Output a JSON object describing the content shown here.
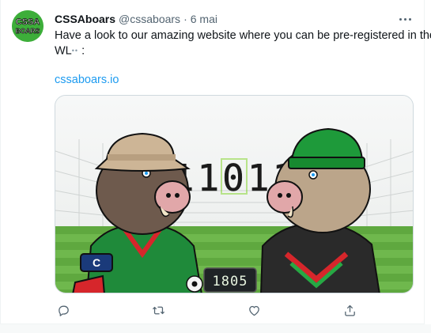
{
  "author": {
    "name": "CSSAboars",
    "handle": "@cssaboars",
    "separator": "·",
    "time": "6 mai",
    "avatar_text_top": "CSSA",
    "avatar_text_bottom": "BOARS"
  },
  "tweet": {
    "text_line1": "Have a look to our amazing website where you can be pre-registered in the",
    "text_line2": "WL",
    "emoji": "••",
    "text_line2_end": " :",
    "link": "cssaboars.io"
  },
  "media": {
    "mint_counter": "11011",
    "scoreboard": "1805",
    "armband_letter": "C"
  },
  "icons": {
    "reply": "reply-icon",
    "retweet": "retweet-icon",
    "like": "heart-icon",
    "share": "share-icon",
    "more": "more-icon"
  },
  "colors": {
    "accent": "#1d9bf0",
    "muted": "#536471",
    "text": "#0f1419",
    "border": "#cfd9de",
    "brand_green": "#3dae3a",
    "counter_green": "#7ed321"
  }
}
